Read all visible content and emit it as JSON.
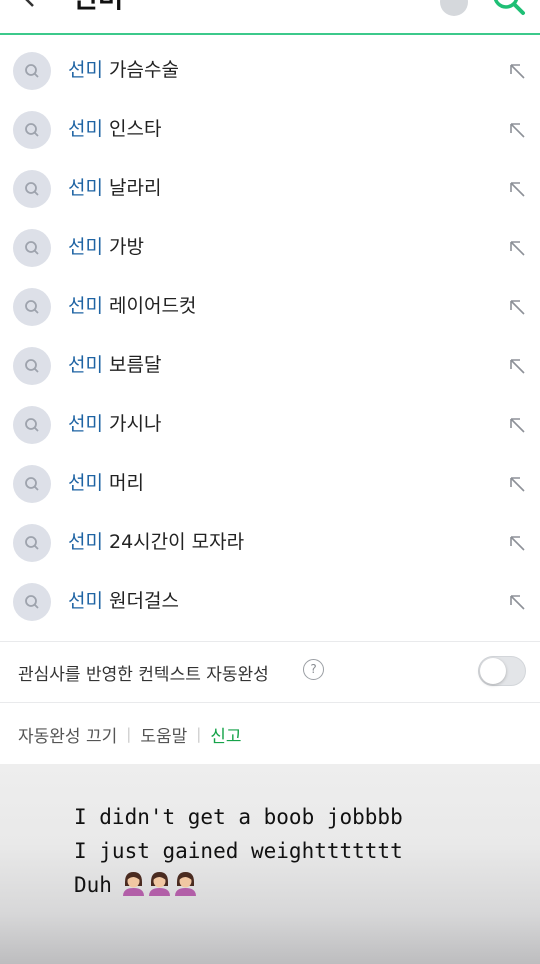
{
  "search": {
    "query": "선미"
  },
  "suggestions": [
    {
      "keyword": "선미",
      "rest": " 가슴수술"
    },
    {
      "keyword": "선미",
      "rest": " 인스타"
    },
    {
      "keyword": "선미",
      "rest": " 날라리"
    },
    {
      "keyword": "선미",
      "rest": " 가방"
    },
    {
      "keyword": "선미",
      "rest": " 레이어드컷"
    },
    {
      "keyword": "선미",
      "rest": " 보름달"
    },
    {
      "keyword": "선미",
      "rest": " 가시나"
    },
    {
      "keyword": "선미",
      "rest": " 머리"
    },
    {
      "keyword": "선미",
      "rest": " 24시간이 모자라"
    },
    {
      "keyword": "선미",
      "rest": " 원더걸스"
    }
  ],
  "context_autocomplete": {
    "label": "관심사를 반영한 컨텍스트 자동완성",
    "help_glyph": "?",
    "enabled": false
  },
  "footer": {
    "turn_off": "자동완성 끄기",
    "help": "도움말",
    "report": "신고"
  },
  "caption": {
    "line1": "I didn't get a boob jobbbb",
    "line2": "I just gained weighttttttt",
    "line3": "Duh"
  },
  "colors": {
    "accent_green": "#3cc98b",
    "keyword_blue": "#1e63a3",
    "report_green": "#16a34a"
  }
}
